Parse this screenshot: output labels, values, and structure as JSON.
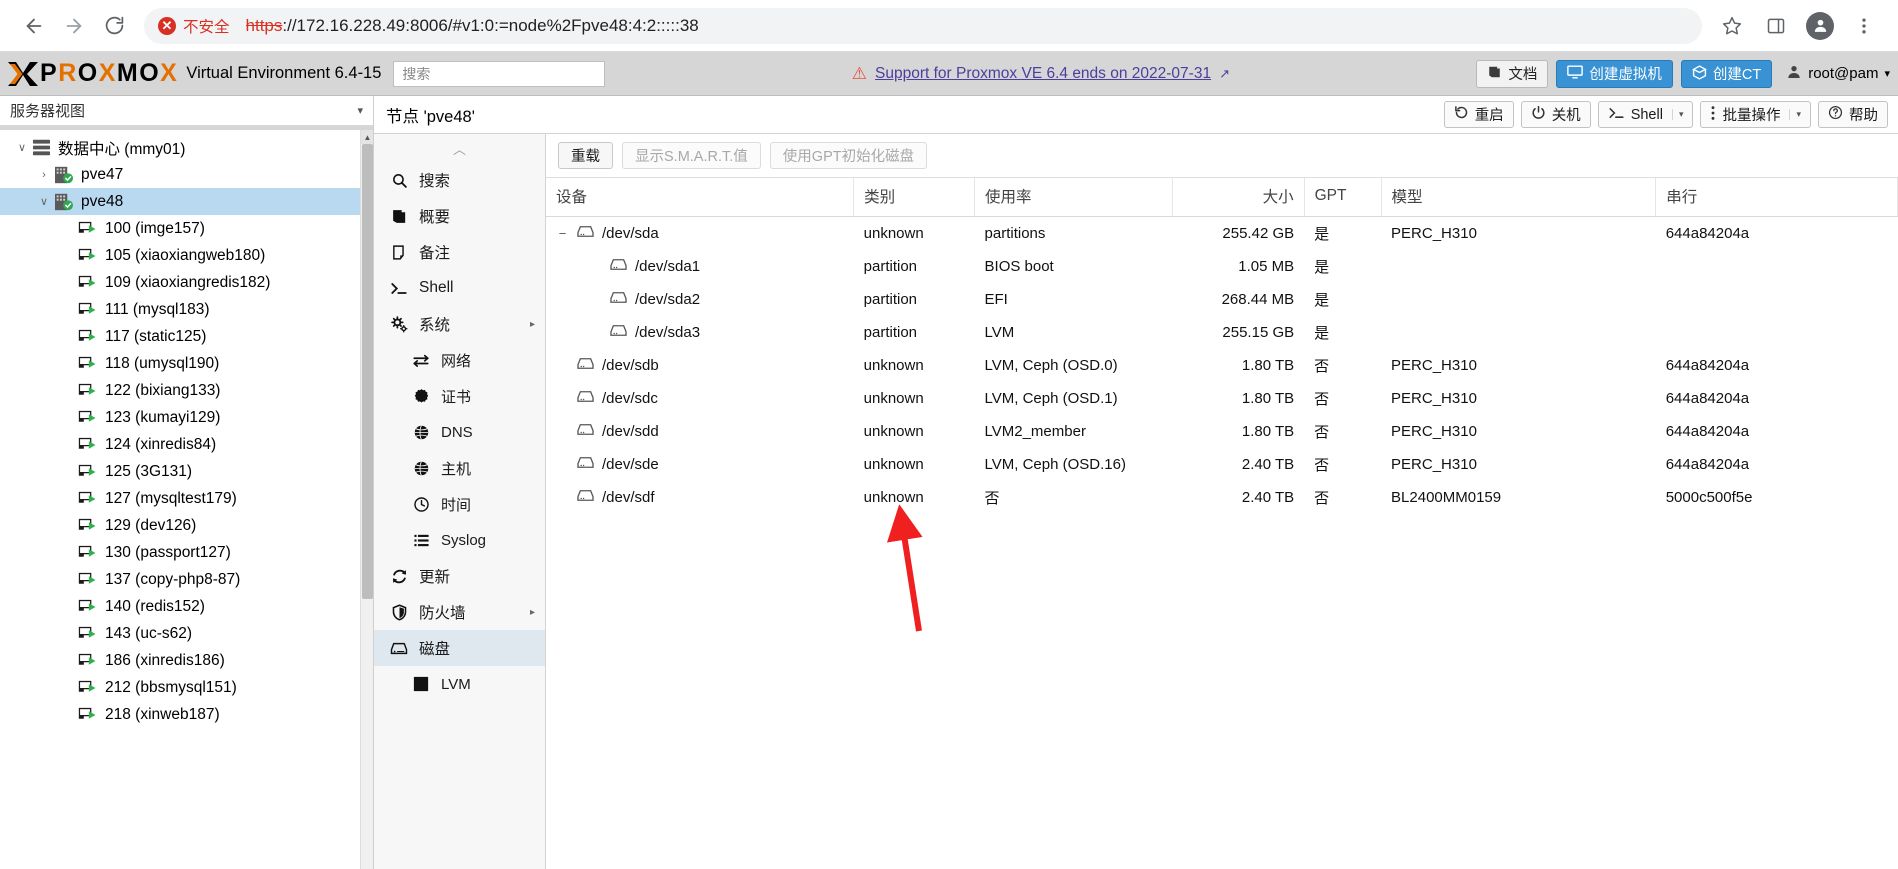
{
  "browser": {
    "back_label": "back",
    "forward_label": "forward",
    "reload_label": "reload",
    "security_badge": "不安全",
    "url_scheme": "https",
    "url_rest": "://172.16.228.49:8006/#v1:0:=node%2Fpve48:4:2:::::38",
    "bookmark_label": "star",
    "sidepanel_label": "side panel",
    "profile_label": "profile",
    "menu_label": "menu"
  },
  "pve_header": {
    "logo": "PROXMOX",
    "product": "Virtual Environment 6.4-15",
    "search_placeholder": "搜索",
    "support_text": "Support for Proxmox VE 6.4 ends on 2022-07-31",
    "docs_label": "文档",
    "create_vm_label": "创建虚拟机",
    "create_ct_label": "创建CT",
    "user_label": "root@pam"
  },
  "tree": {
    "view_label": "服务器视图",
    "items": [
      {
        "label": "数据中心 (mmy01)",
        "level": 1,
        "icon": "datacenter-icon",
        "twisty": "expanded",
        "selected": false
      },
      {
        "label": "pve47",
        "level": 2,
        "icon": "node-icon",
        "twisty": "collapsed",
        "selected": false
      },
      {
        "label": "pve48",
        "level": 2,
        "icon": "node-icon",
        "twisty": "expanded",
        "selected": true
      },
      {
        "label": "100 (imge157)",
        "level": 3,
        "icon": "vm-icon",
        "twisty": "",
        "selected": false
      },
      {
        "label": "105 (xiaoxiangweb180)",
        "level": 3,
        "icon": "vm-icon",
        "twisty": "",
        "selected": false
      },
      {
        "label": "109 (xiaoxiangredis182)",
        "level": 3,
        "icon": "vm-icon",
        "twisty": "",
        "selected": false
      },
      {
        "label": "111 (mysql183)",
        "level": 3,
        "icon": "vm-icon",
        "twisty": "",
        "selected": false
      },
      {
        "label": "117 (static125)",
        "level": 3,
        "icon": "vm-icon",
        "twisty": "",
        "selected": false
      },
      {
        "label": "118 (umysql190)",
        "level": 3,
        "icon": "vm-icon",
        "twisty": "",
        "selected": false
      },
      {
        "label": "122 (bixiang133)",
        "level": 3,
        "icon": "vm-icon",
        "twisty": "",
        "selected": false
      },
      {
        "label": "123 (kumayi129)",
        "level": 3,
        "icon": "vm-icon",
        "twisty": "",
        "selected": false
      },
      {
        "label": "124 (xinredis84)",
        "level": 3,
        "icon": "vm-icon",
        "twisty": "",
        "selected": false
      },
      {
        "label": "125 (3G131)",
        "level": 3,
        "icon": "vm-icon",
        "twisty": "",
        "selected": false
      },
      {
        "label": "127 (mysqltest179)",
        "level": 3,
        "icon": "vm-icon",
        "twisty": "",
        "selected": false
      },
      {
        "label": "129 (dev126)",
        "level": 3,
        "icon": "vm-icon",
        "twisty": "",
        "selected": false
      },
      {
        "label": "130 (passport127)",
        "level": 3,
        "icon": "vm-icon",
        "twisty": "",
        "selected": false
      },
      {
        "label": "137 (copy-php8-87)",
        "level": 3,
        "icon": "vm-icon",
        "twisty": "",
        "selected": false
      },
      {
        "label": "140 (redis152)",
        "level": 3,
        "icon": "vm-icon",
        "twisty": "",
        "selected": false
      },
      {
        "label": "143 (uc-s62)",
        "level": 3,
        "icon": "vm-icon",
        "twisty": "",
        "selected": false
      },
      {
        "label": "186 (xinredis186)",
        "level": 3,
        "icon": "vm-icon",
        "twisty": "",
        "selected": false
      },
      {
        "label": "212 (bbsmysql151)",
        "level": 3,
        "icon": "vm-icon",
        "twisty": "",
        "selected": false
      },
      {
        "label": "218 (xinweb187)",
        "level": 3,
        "icon": "vm-icon",
        "twisty": "",
        "selected": false
      }
    ]
  },
  "node": {
    "title": "节点 'pve48'",
    "buttons": [
      {
        "label": "重启",
        "icon": "restart-icon",
        "caret": false
      },
      {
        "label": "关机",
        "icon": "power-icon",
        "caret": false
      },
      {
        "label": "Shell",
        "icon": "shell-icon",
        "caret": true
      },
      {
        "label": "批量操作",
        "icon": "vertical-dots-icon",
        "caret": true
      },
      {
        "label": "帮助",
        "icon": "help-icon",
        "caret": false
      }
    ],
    "menu": [
      {
        "label": "搜索",
        "icon": "search-icon",
        "level": 1,
        "active": false,
        "arrow": false
      },
      {
        "label": "概要",
        "icon": "book-icon",
        "level": 1,
        "active": false,
        "arrow": false
      },
      {
        "label": "备注",
        "icon": "note-icon",
        "level": 1,
        "active": false,
        "arrow": false
      },
      {
        "label": "Shell",
        "icon": "terminal-icon",
        "level": 1,
        "active": false,
        "arrow": false
      },
      {
        "label": "系统",
        "icon": "gears-icon",
        "level": 1,
        "active": false,
        "arrow": true
      },
      {
        "label": "网络",
        "icon": "network-icon",
        "level": 2,
        "active": false,
        "arrow": false
      },
      {
        "label": "证书",
        "icon": "certificate-icon",
        "level": 2,
        "active": false,
        "arrow": false
      },
      {
        "label": "DNS",
        "icon": "globe-icon",
        "level": 2,
        "active": false,
        "arrow": false
      },
      {
        "label": "主机",
        "icon": "globe-icon",
        "level": 2,
        "active": false,
        "arrow": false
      },
      {
        "label": "时间",
        "icon": "clock-icon",
        "level": 2,
        "active": false,
        "arrow": false
      },
      {
        "label": "Syslog",
        "icon": "list-icon",
        "level": 2,
        "active": false,
        "arrow": false
      },
      {
        "label": "更新",
        "icon": "refresh-icon",
        "level": 1,
        "active": false,
        "arrow": false
      },
      {
        "label": "防火墙",
        "icon": "shield-icon",
        "level": 1,
        "active": false,
        "arrow": true
      },
      {
        "label": "磁盘",
        "icon": "disk-icon",
        "level": 1,
        "active": true,
        "arrow": false
      },
      {
        "label": "LVM",
        "icon": "lvm-icon",
        "level": 2,
        "active": false,
        "arrow": false
      }
    ]
  },
  "disks": {
    "toolbar": [
      {
        "label": "重载",
        "disabled": false
      },
      {
        "label": "显示S.M.A.R.T.值",
        "disabled": true
      },
      {
        "label": "使用GPT初始化磁盘",
        "disabled": true
      }
    ],
    "columns": [
      "设备",
      "类别",
      "使用率",
      "大小",
      "GPT",
      "模型",
      "串行"
    ],
    "rows": [
      {
        "device": "/dev/sda",
        "indent": 0,
        "twisty": "−",
        "type": "unknown",
        "usage": "partitions",
        "size": "255.42 GB",
        "gpt": "是",
        "model": "PERC_H310",
        "serial": "644a84204a"
      },
      {
        "device": "/dev/sda1",
        "indent": 1,
        "twisty": "",
        "type": "partition",
        "usage": "BIOS boot",
        "size": "1.05 MB",
        "gpt": "是",
        "model": "",
        "serial": ""
      },
      {
        "device": "/dev/sda2",
        "indent": 1,
        "twisty": "",
        "type": "partition",
        "usage": "EFI",
        "size": "268.44 MB",
        "gpt": "是",
        "model": "",
        "serial": ""
      },
      {
        "device": "/dev/sda3",
        "indent": 1,
        "twisty": "",
        "type": "partition",
        "usage": "LVM",
        "size": "255.15 GB",
        "gpt": "是",
        "model": "",
        "serial": ""
      },
      {
        "device": "/dev/sdb",
        "indent": 0,
        "twisty": "",
        "type": "unknown",
        "usage": "LVM, Ceph (OSD.0)",
        "size": "1.80 TB",
        "gpt": "否",
        "model": "PERC_H310",
        "serial": "644a84204a"
      },
      {
        "device": "/dev/sdc",
        "indent": 0,
        "twisty": "",
        "type": "unknown",
        "usage": "LVM, Ceph (OSD.1)",
        "size": "1.80 TB",
        "gpt": "否",
        "model": "PERC_H310",
        "serial": "644a84204a"
      },
      {
        "device": "/dev/sdd",
        "indent": 0,
        "twisty": "",
        "type": "unknown",
        "usage": "LVM2_member",
        "size": "1.80 TB",
        "gpt": "否",
        "model": "PERC_H310",
        "serial": "644a84204a"
      },
      {
        "device": "/dev/sde",
        "indent": 0,
        "twisty": "",
        "type": "unknown",
        "usage": "LVM, Ceph (OSD.16)",
        "size": "2.40 TB",
        "gpt": "否",
        "model": "PERC_H310",
        "serial": "644a84204a"
      },
      {
        "device": "/dev/sdf",
        "indent": 0,
        "twisty": "",
        "type": "unknown",
        "usage": "否",
        "size": "2.40 TB",
        "gpt": "否",
        "model": "BL2400MM0159",
        "serial": "5000c500f5e"
      }
    ]
  },
  "annotation": {
    "arrow_color": "#f02020",
    "name": "red-arrow-annotation"
  }
}
